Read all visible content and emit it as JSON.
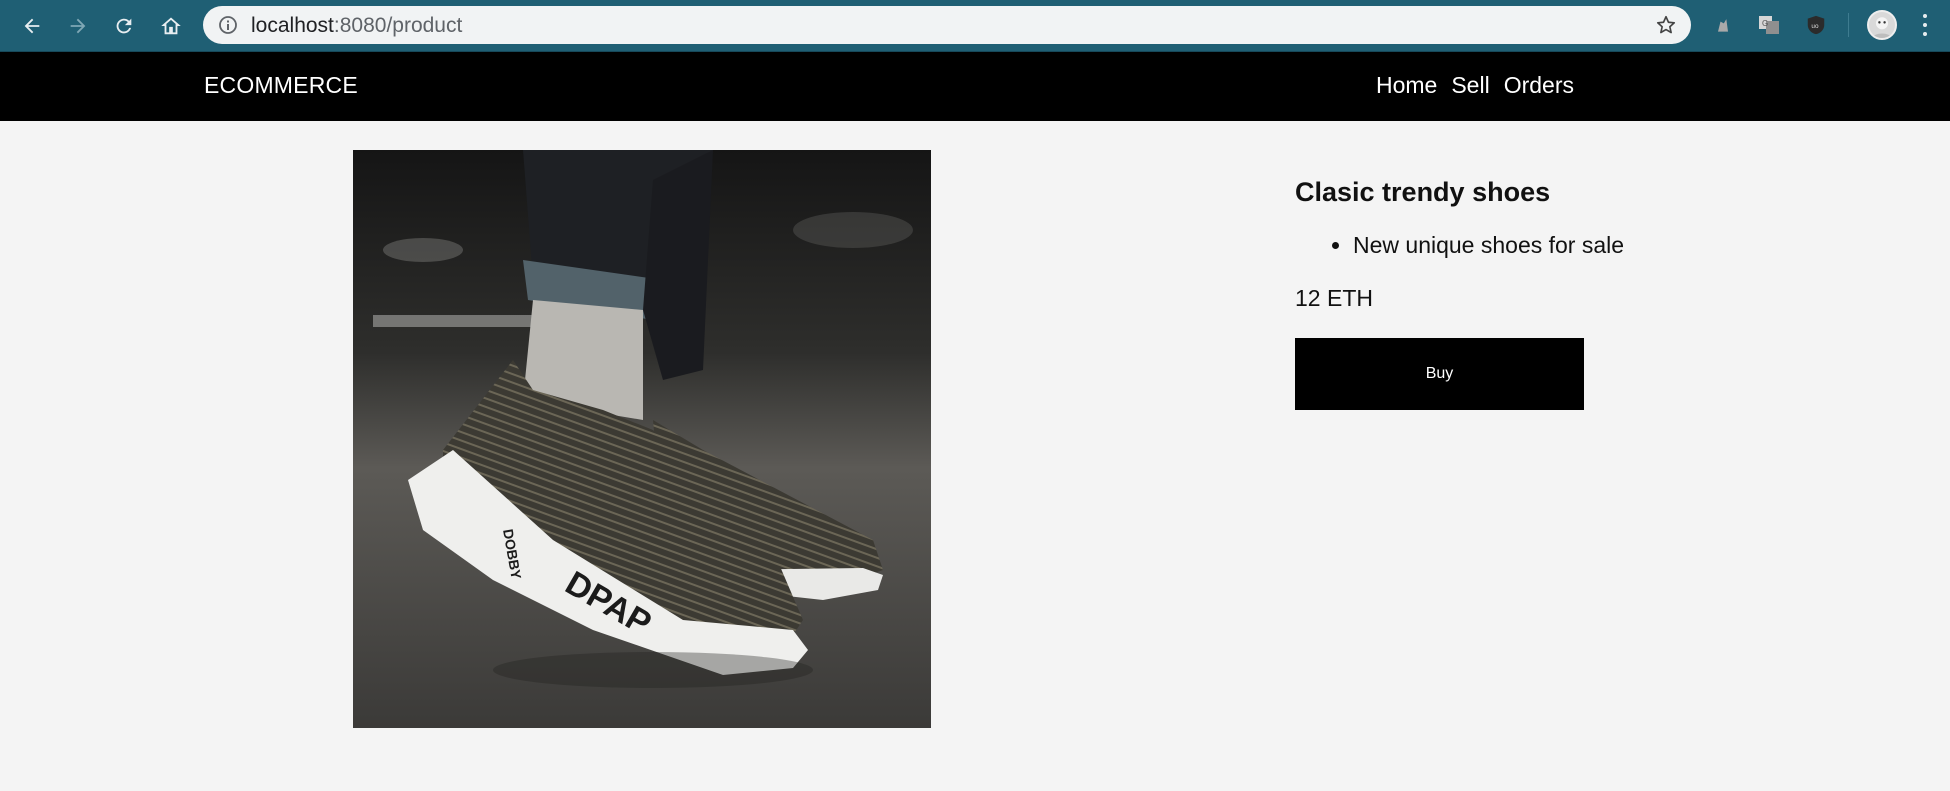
{
  "browser": {
    "url_host": "localhost",
    "url_path": ":8080/product",
    "icons": [
      "back-icon",
      "forward-icon",
      "reload-icon",
      "home-icon",
      "info-icon",
      "star-icon",
      "extension-icon",
      "translate-icon",
      "ublock-icon",
      "avatar",
      "menu-icon"
    ]
  },
  "header": {
    "brand": "ECOMMERCE",
    "nav": {
      "home": "Home",
      "sell": "Sell",
      "orders": "Orders"
    }
  },
  "product": {
    "title": "Clasic trendy shoes",
    "description": "New unique shoes for sale",
    "price": "12 ETH",
    "buy_label": "Buy",
    "image_alt": "Photo of knit sneakers with white soles"
  }
}
